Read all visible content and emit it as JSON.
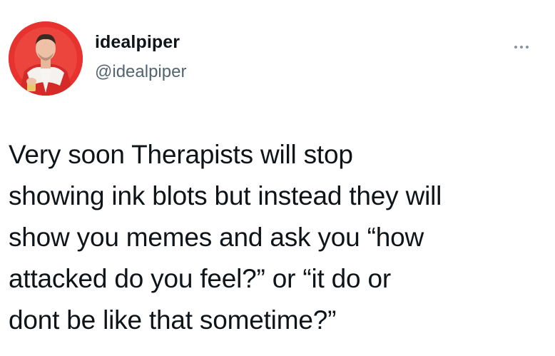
{
  "tweet": {
    "author": {
      "display_name": "idealpiper",
      "handle": "@idealpiper",
      "avatar_icon": "profile-avatar"
    },
    "more_icon": "more-options-icon",
    "text": "Very soon Therapists will stop\nshowing ink blots but instead they will\nshow you memes and ask you “how\nattacked do you feel?” or “it do or\ndont be like that sometime?”"
  },
  "colors": {
    "text": "#0f1419",
    "secondary_text": "#536471",
    "avatar_background": "#e9302d"
  }
}
